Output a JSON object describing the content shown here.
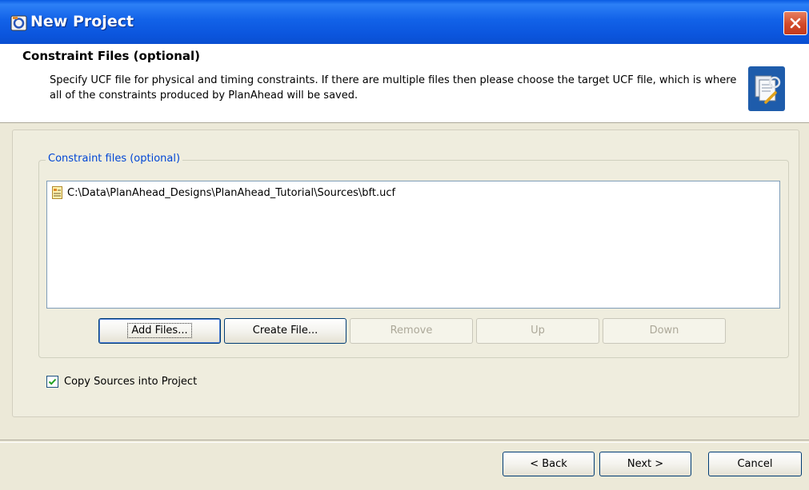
{
  "window": {
    "title": "New Project"
  },
  "header": {
    "title": "Constraint Files (optional)",
    "description": "Specify UCF file for physical and timing constraints. If there are multiple files then please choose the target UCF file, which is where all of the constraints produced by PlanAhead will be saved."
  },
  "constraints": {
    "group_label": "Constraint files (optional)",
    "files": [
      {
        "path": "C:\\Data\\PlanAhead_Designs\\PlanAhead_Tutorial\\Sources\\bft.ucf",
        "icon": "ucf-file-icon"
      }
    ],
    "buttons": {
      "add_files": "Add Files...",
      "create_file": "Create File...",
      "remove": "Remove",
      "up": "Up",
      "down": "Down"
    }
  },
  "options": {
    "copy_sources_label": "Copy Sources into Project",
    "copy_sources_checked": true
  },
  "footer": {
    "back": "< Back",
    "next": "Next >",
    "cancel": "Cancel"
  },
  "colors": {
    "titlebar": "#0b55dd",
    "accent_text": "#0046d5",
    "close_button": "#d24a2a",
    "dialog_bg": "#ece9d8"
  }
}
